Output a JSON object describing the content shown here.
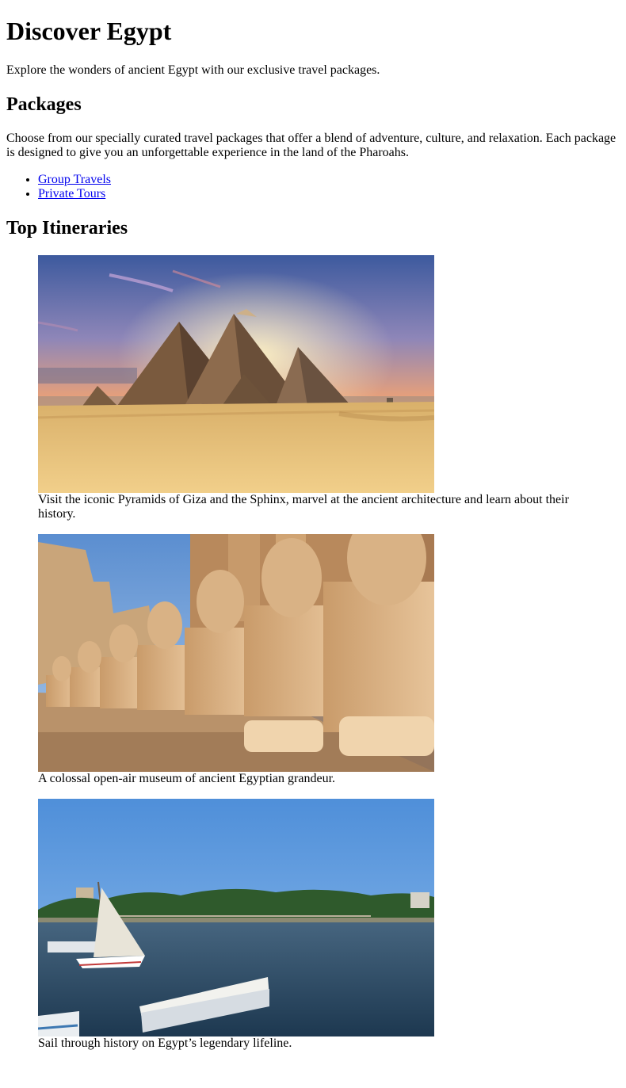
{
  "header": {
    "title": "Discover Egypt",
    "intro": "Explore the wonders of ancient Egypt with our exclusive travel packages."
  },
  "packages": {
    "heading": "Packages",
    "description": "Choose from our specially curated travel packages that offer a blend of adventure, culture, and relaxation. Each package is designed to give you an unforgettable experience in the land of the Pharoahs.",
    "links": [
      {
        "label": "Group Travels"
      },
      {
        "label": "Private Tours"
      }
    ]
  },
  "itineraries": {
    "heading": "Top Itineraries",
    "items": [
      {
        "image": "pyramids-of-giza-photo",
        "caption": "Visit the iconic Pyramids of Giza and the Sphinx, marvel at the ancient architecture and learn about their history."
      },
      {
        "image": "karnak-ram-sphinxes-photo",
        "caption": "A colossal open-air museum of ancient Egyptian grandeur."
      },
      {
        "image": "nile-felucca-photo",
        "caption": "Sail through history on Egypt’s legendary lifeline."
      }
    ]
  },
  "colors": {
    "link": "#0000ee",
    "text": "#000000",
    "background": "#ffffff"
  }
}
